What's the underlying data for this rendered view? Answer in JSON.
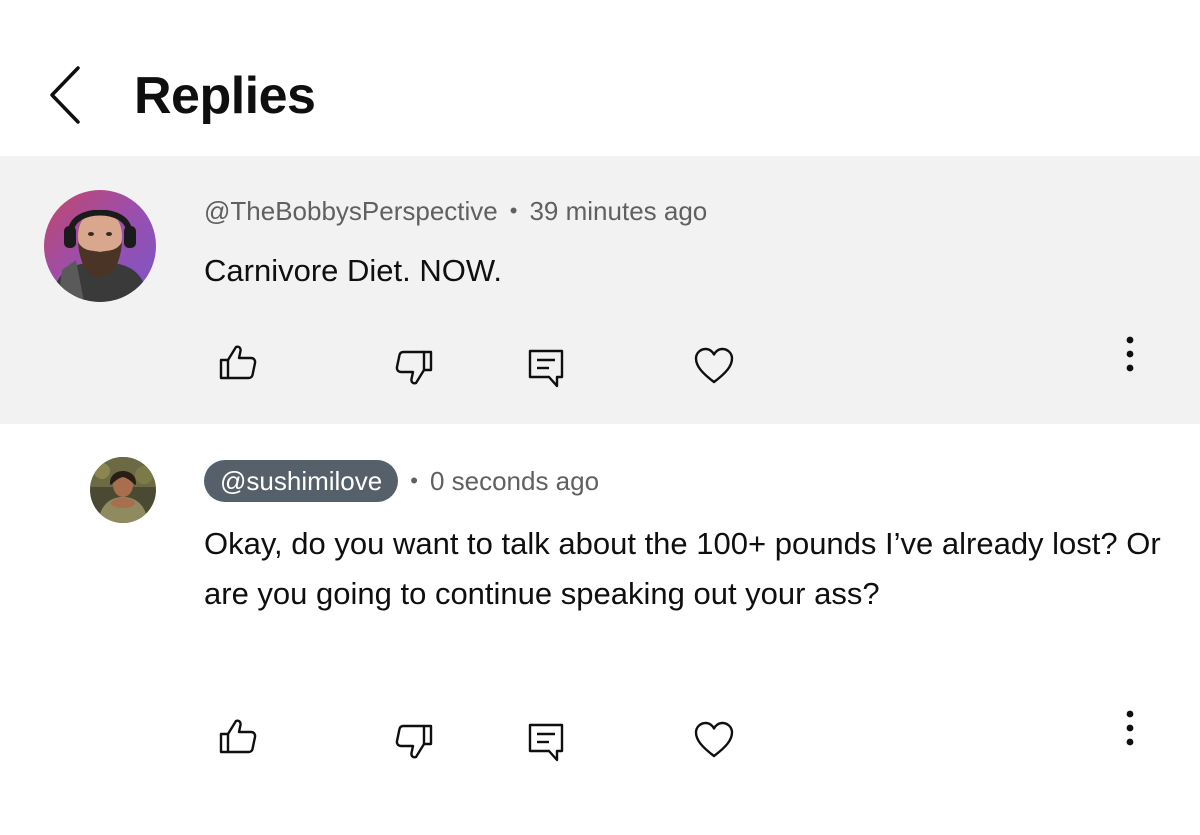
{
  "header": {
    "title": "Replies",
    "back_icon": "chevron-left-icon"
  },
  "parent_comment": {
    "author": "@TheBobbysPerspective",
    "separator": "•",
    "time": "39 minutes ago",
    "text": "Carnivore Diet. NOW.",
    "actions": [
      "thumbs-up-icon",
      "thumbs-down-icon",
      "reply-icon",
      "heart-icon",
      "more-vertical-icon"
    ],
    "background": "#f2f2f2"
  },
  "reply_comment": {
    "author": "@sushimilove",
    "separator": "•",
    "time": "0 seconds ago",
    "text": "Okay, do you want to talk about the 100+ pounds I’ve already lost? Or are you going to continue speaking out your ass?",
    "author_chip_color": "#56606a",
    "actions": [
      "thumbs-up-icon",
      "thumbs-down-icon",
      "reply-icon",
      "heart-icon",
      "more-vertical-icon"
    ]
  }
}
